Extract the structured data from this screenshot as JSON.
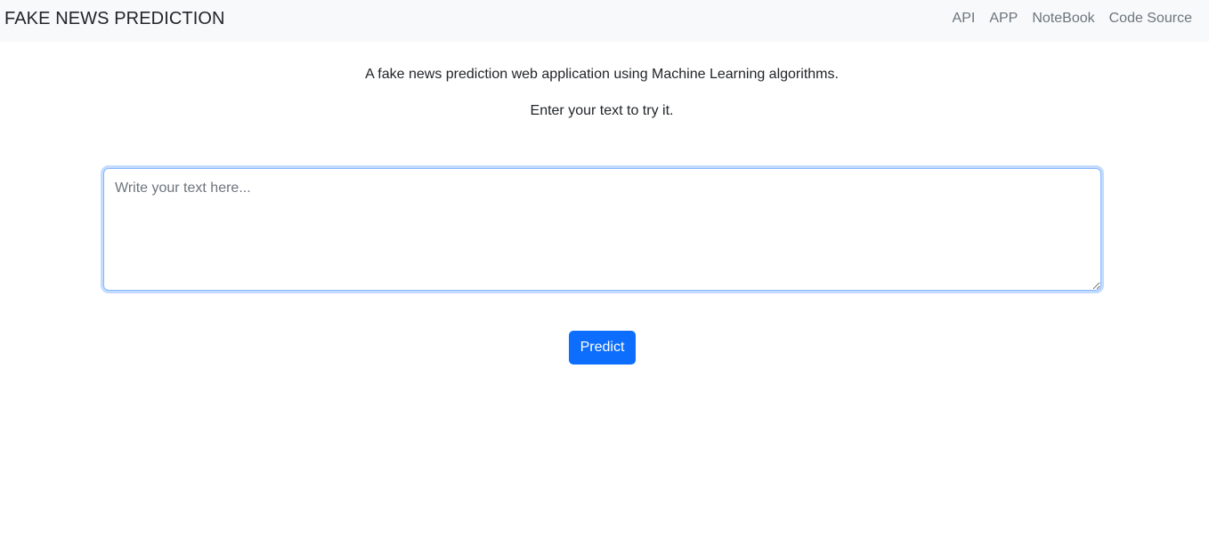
{
  "navbar": {
    "brand": "FAKE NEWS PREDICTION",
    "links": [
      "API",
      "APP",
      "NoteBook",
      "Code Source"
    ]
  },
  "intro": {
    "line1": "A fake news prediction web application using Machine Learning algorithms.",
    "line2": "Enter your text to try it."
  },
  "form": {
    "textarea_value": "",
    "textarea_placeholder": "Write your text here...",
    "predict_label": "Predict"
  },
  "colors": {
    "primary": "#0d6efd",
    "navbar_bg": "#f8f9fa",
    "nav_link": "#6c757d",
    "text": "#212529"
  }
}
